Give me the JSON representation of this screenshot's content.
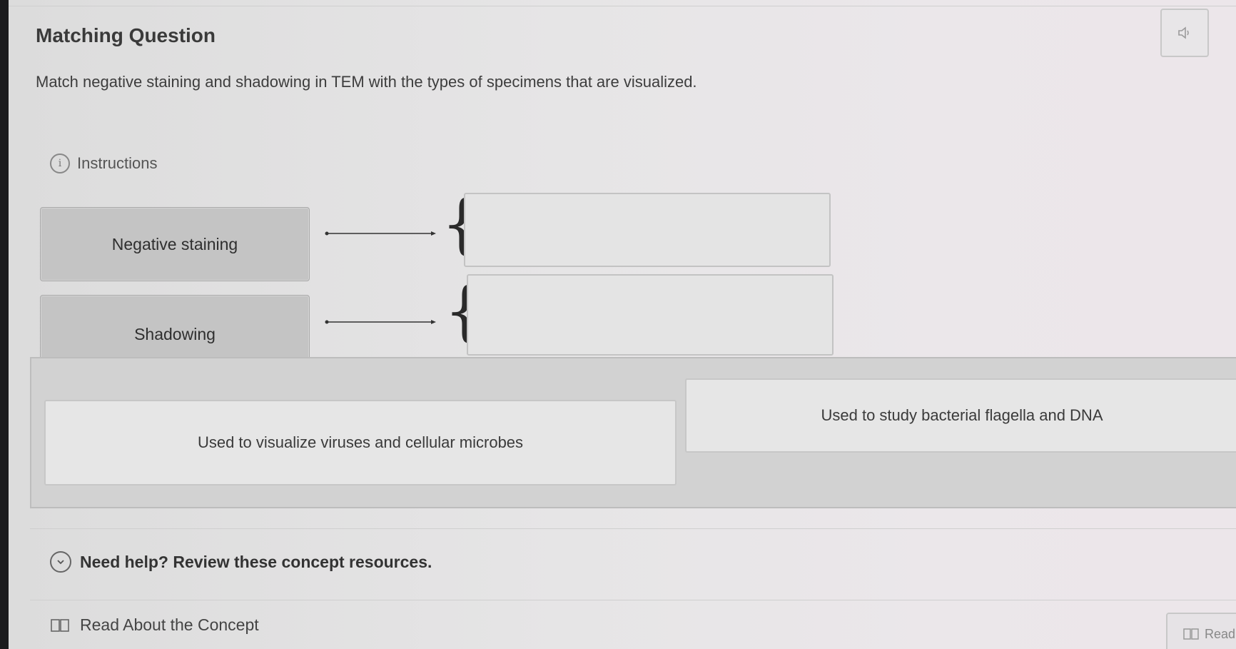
{
  "header": {
    "title": "Matching Question",
    "audio_icon": "speaker-icon"
  },
  "question": {
    "prompt": "Match negative staining and shadowing in TEM with the types of specimens that are visualized."
  },
  "instructions": {
    "label": "Instructions",
    "icon": "info-icon"
  },
  "terms": [
    {
      "label": "Negative staining"
    },
    {
      "label": "Shadowing"
    }
  ],
  "answer_bank": [
    {
      "label": "Used to visualize viruses and cellular microbes"
    },
    {
      "label": "Used to study bacterial flagella and DNA"
    }
  ],
  "help": {
    "label": "Need help? Review these concept resources.",
    "icon": "chevron-down-icon"
  },
  "resources": {
    "read_label": "Read About the Concept",
    "read_button_label": "Read",
    "icon": "book-icon"
  }
}
